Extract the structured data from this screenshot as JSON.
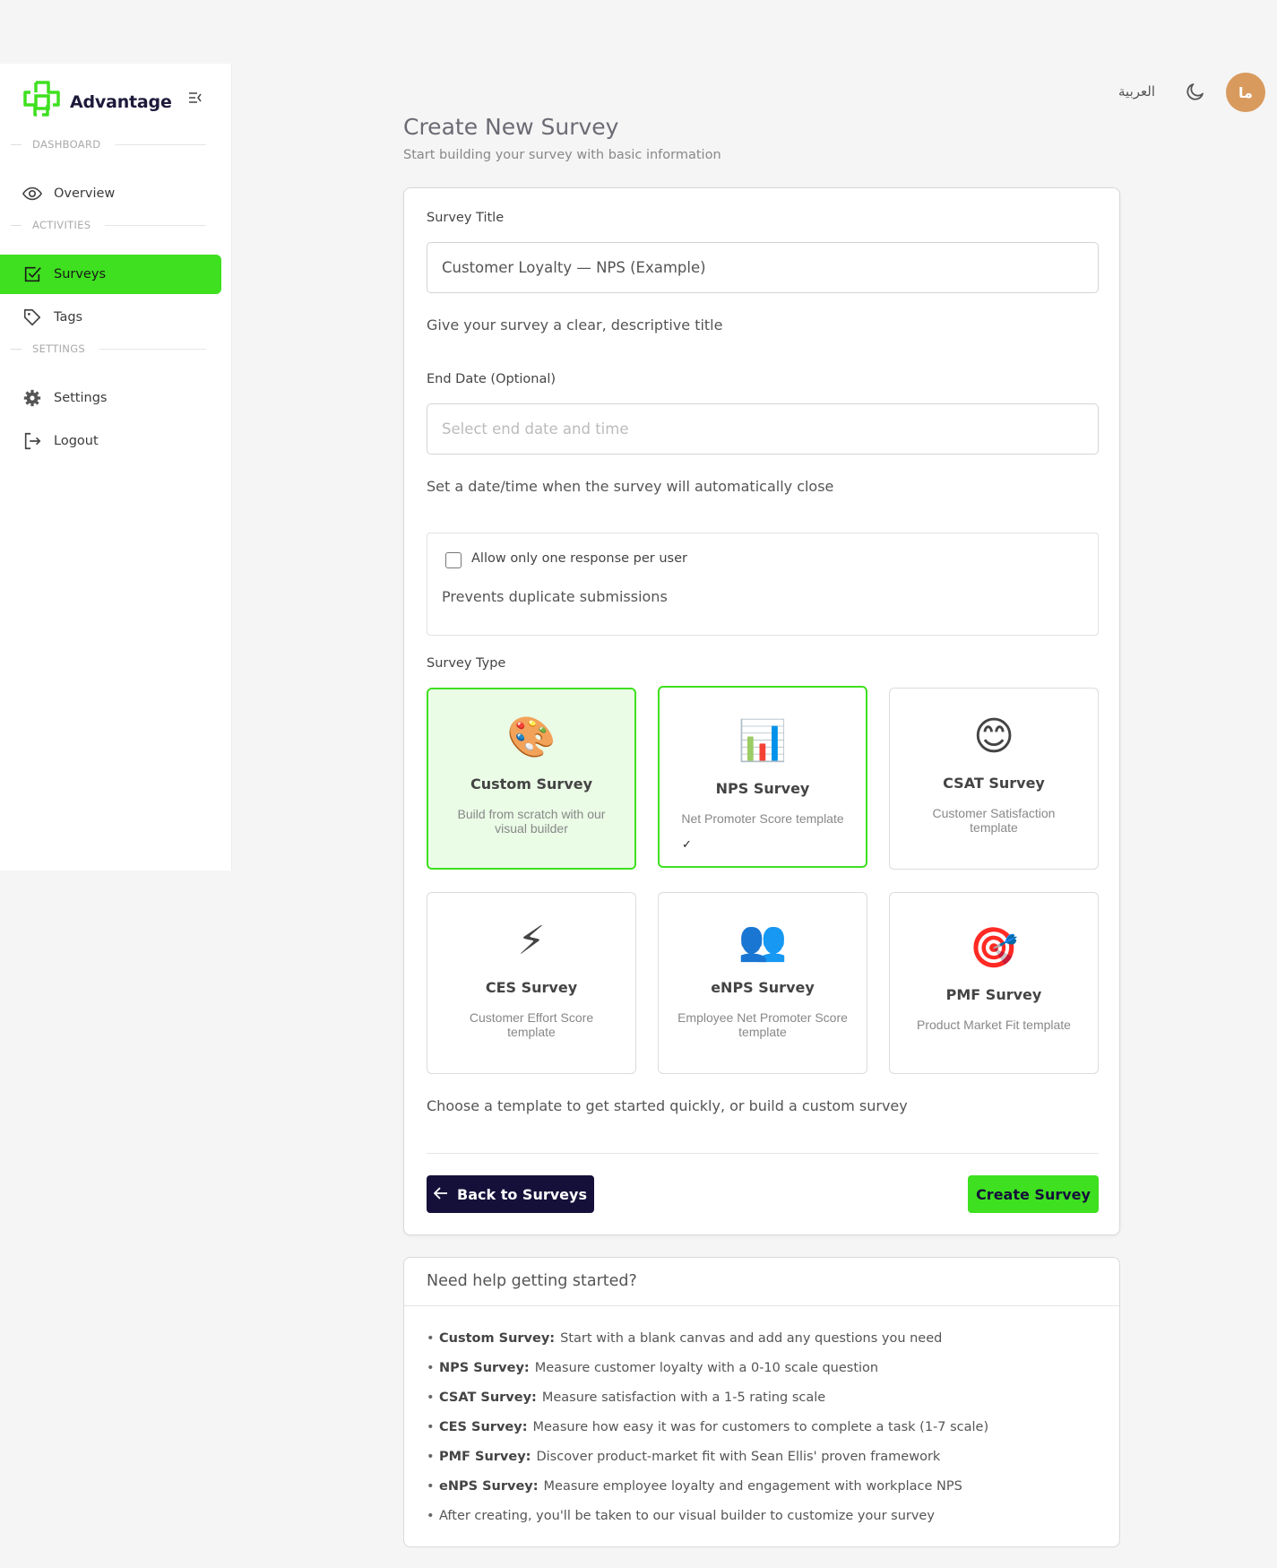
{
  "app": {
    "brand": "Advantage",
    "language_toggle": "العربية",
    "avatar_initials": "ما",
    "brand_color": "#3ee01f",
    "dark_color": "#15103a"
  },
  "sidebar": {
    "sections": [
      {
        "label": "DASHBOARD"
      },
      {
        "label": "ACTIVITIES"
      },
      {
        "label": "SETTINGS"
      }
    ],
    "items": [
      {
        "label": "Overview",
        "icon": "eye-icon"
      },
      {
        "label": "Surveys",
        "icon": "check-square-icon",
        "active": true
      },
      {
        "label": "Tags",
        "icon": "tag-icon"
      },
      {
        "label": "Settings",
        "icon": "gear-icon"
      },
      {
        "label": "Logout",
        "icon": "logout-icon"
      }
    ]
  },
  "header": {
    "title": "Create New Survey",
    "subtitle": "Start building your survey with basic information"
  },
  "form": {
    "title_label": "Survey Title",
    "title_value": "Customer Loyalty — NPS (Example)",
    "title_help": "Give your survey a clear, descriptive title",
    "end_date_label": "End Date (Optional)",
    "end_date_placeholder": "Select end date and time",
    "end_date_help": "Set a date/time when the survey will automatically close",
    "one_response_label": "Allow only one response per user",
    "one_response_checked": false,
    "one_response_help": "Prevents duplicate submissions",
    "type_label": "Survey Type",
    "types": [
      {
        "name": "Custom Survey",
        "desc": "Build from scratch with our visual builder",
        "icon": "palette-icon",
        "glyph": "🎨"
      },
      {
        "name": "NPS Survey",
        "desc": "Net Promoter Score template",
        "icon": "bar-chart-icon",
        "glyph": "📊",
        "selected": true,
        "check": "✓"
      },
      {
        "name": "CSAT Survey",
        "desc": "Customer Satisfaction template",
        "icon": "smile-icon",
        "glyph": "😊"
      },
      {
        "name": "CES Survey",
        "desc": "Customer Effort Score template",
        "icon": "lightning-icon",
        "glyph": "⚡"
      },
      {
        "name": "eNPS Survey",
        "desc": "Employee Net Promoter Score template",
        "icon": "people-icon",
        "glyph": "👥"
      },
      {
        "name": "PMF Survey",
        "desc": "Product Market Fit template",
        "icon": "target-icon",
        "glyph": "🎯"
      }
    ],
    "type_help": "Choose a template to get started quickly, or build a custom survey",
    "back_label": "Back to Surveys",
    "create_label": "Create Survey"
  },
  "help": {
    "title": "Need help getting started?",
    "items": [
      {
        "term": "Custom Survey:",
        "text": "Start with a blank canvas and add any questions you need"
      },
      {
        "term": "NPS Survey:",
        "text": "Measure customer loyalty with a 0-10 scale question"
      },
      {
        "term": "CSAT Survey:",
        "text": "Measure satisfaction with a 1-5 rating scale"
      },
      {
        "term": "CES Survey:",
        "text": "Measure how easy it was for customers to complete a task (1-7 scale)"
      },
      {
        "term": "PMF Survey:",
        "text": "Discover product-market fit with Sean Ellis' proven framework"
      },
      {
        "term": "eNPS Survey:",
        "text": "Measure employee loyalty and engagement with workplace NPS"
      },
      {
        "term": "",
        "text": "After creating, you'll be taken to our visual builder to customize your survey"
      }
    ]
  }
}
